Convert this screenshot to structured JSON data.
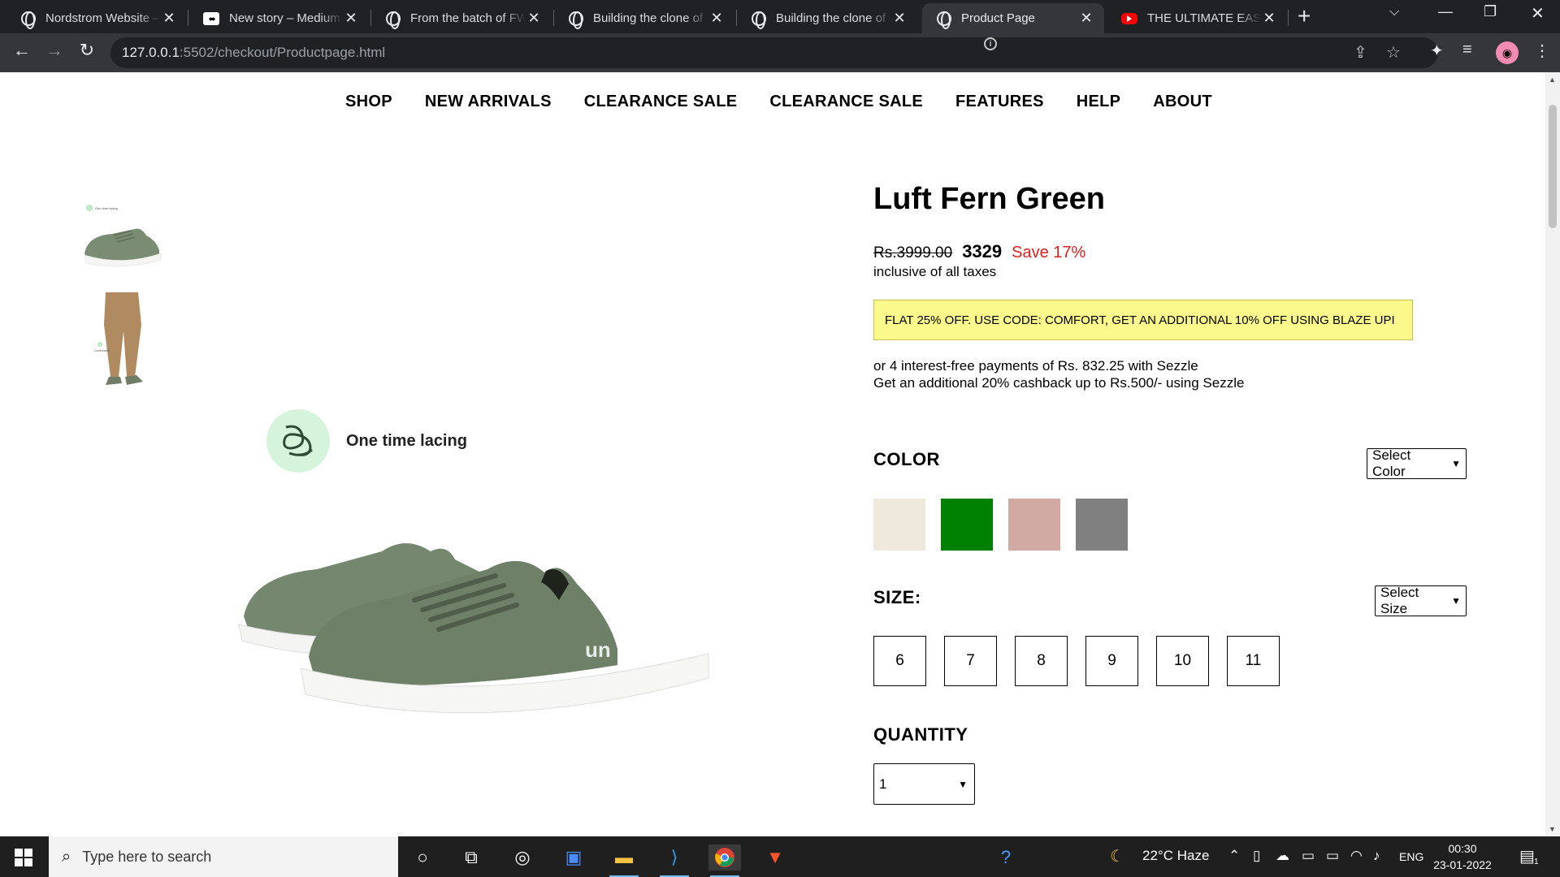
{
  "browser": {
    "tabs": [
      {
        "title": "Nordstrom Website – ",
        "icon": "globe-icon",
        "active": false
      },
      {
        "title": "New story – Medium",
        "icon": "medium-icon",
        "active": false
      },
      {
        "title": "From the batch of FW",
        "icon": "globe-icon",
        "active": false
      },
      {
        "title": "Building the clone of",
        "icon": "globe-icon",
        "active": false
      },
      {
        "title": "Building the clone of",
        "icon": "globe-icon",
        "active": false
      },
      {
        "title": "Product Page",
        "icon": "globe-icon",
        "active": true
      },
      {
        "title": "THE ULTIMATE EASY M",
        "icon": "youtube-icon",
        "active": false
      }
    ],
    "url_host": "127.0.0.1",
    "url_path": ":5502/checkout/Productpage.html"
  },
  "nav": {
    "items": [
      "SHOP",
      "NEW ARRIVALS",
      "CLEARANCE SALE",
      "CLEARANCE SALE",
      "FEATURES",
      "HELP",
      "ABOUT"
    ]
  },
  "gallery": {
    "feature_label": "One time lacing",
    "thumb1_caption": "One time lacing",
    "thumb2_caption": "Comfortable"
  },
  "product": {
    "title": "Luft Fern Green",
    "mrp": "Rs.3999.00",
    "price": "3329",
    "save": "Save 17%",
    "taxes": "inclusive of all taxes",
    "promo": "FLAT 25% OFF. USE CODE: COMFORT, GET AN ADDITIONAL 10% OFF USING BLAZE UPI",
    "sezzle_line1": "or 4 interest-free payments of Rs. 832.25 with Sezzle",
    "sezzle_line2": "Get an additional 20% cashback up to Rs.500/- using Sezzle"
  },
  "color": {
    "label": "COLOR",
    "select_label": "Select Color",
    "swatches": [
      "#efe8dc",
      "#008000",
      "#d1aaa3",
      "#808080"
    ]
  },
  "size": {
    "label": "SIZE:",
    "select_label": "Select Size",
    "options": [
      "6",
      "7",
      "8",
      "9",
      "10",
      "11"
    ]
  },
  "quantity": {
    "label": "QUANTITY",
    "value": "1"
  },
  "taskbar": {
    "search_placeholder": "Type here to search",
    "weather": "22°C  Haze",
    "lang": "ENG",
    "time": "00:30",
    "date": "23-01-2022",
    "notifications": "1"
  }
}
